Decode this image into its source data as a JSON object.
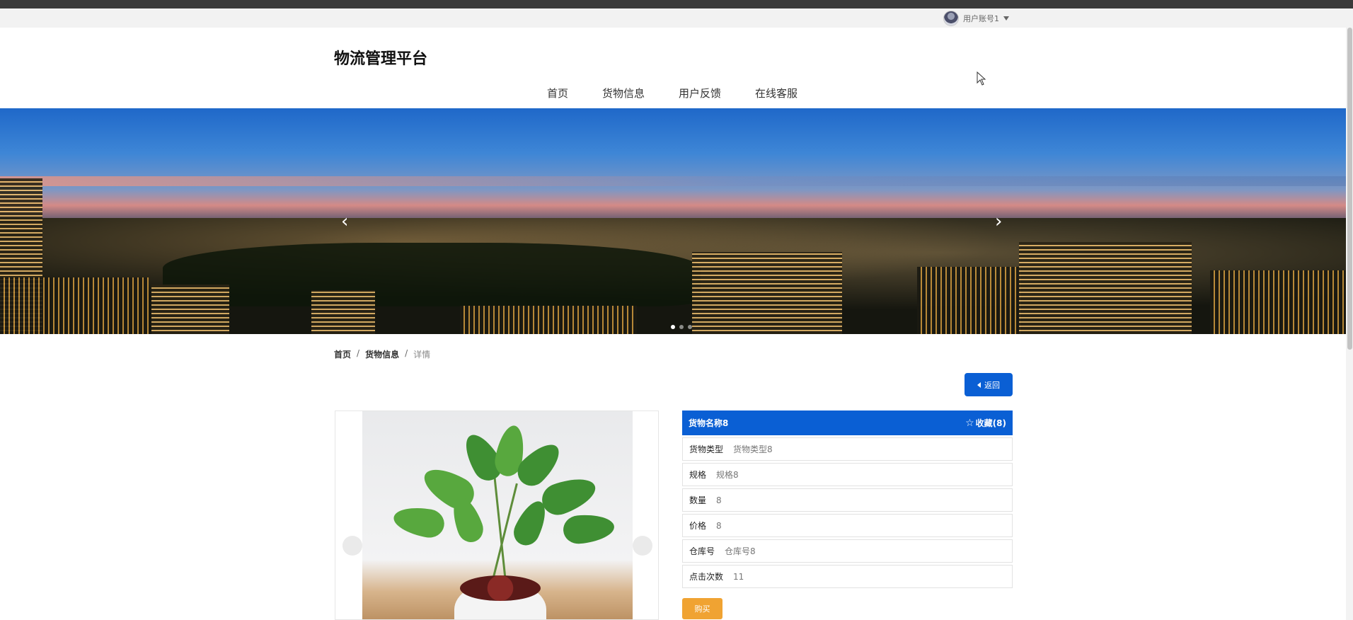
{
  "topbar": {
    "user_label": "用户账号1"
  },
  "header": {
    "site_title": "物流管理平台",
    "nav": [
      "首页",
      "货物信息",
      "用户反馈",
      "在线客服"
    ]
  },
  "banner": {
    "slides_count": 3,
    "active_slide": 1
  },
  "breadcrumb": {
    "home": "首页",
    "section": "货物信息",
    "current": "详情",
    "separator": "/"
  },
  "actions": {
    "back_label": "返回",
    "buy_label": "购买"
  },
  "product": {
    "name": "货物名称8",
    "favorite_label": "收藏(8)",
    "fields": [
      {
        "label": "货物类型",
        "value": "货物类型8"
      },
      {
        "label": "规格",
        "value": "规格8"
      },
      {
        "label": "数量",
        "value": "8"
      },
      {
        "label": "价格",
        "value": "8"
      },
      {
        "label": "仓库号",
        "value": "仓库号8"
      },
      {
        "label": "点击次数",
        "value": "11"
      }
    ]
  },
  "colors": {
    "primary": "#0a5fd4",
    "buy": "#f0a332"
  }
}
